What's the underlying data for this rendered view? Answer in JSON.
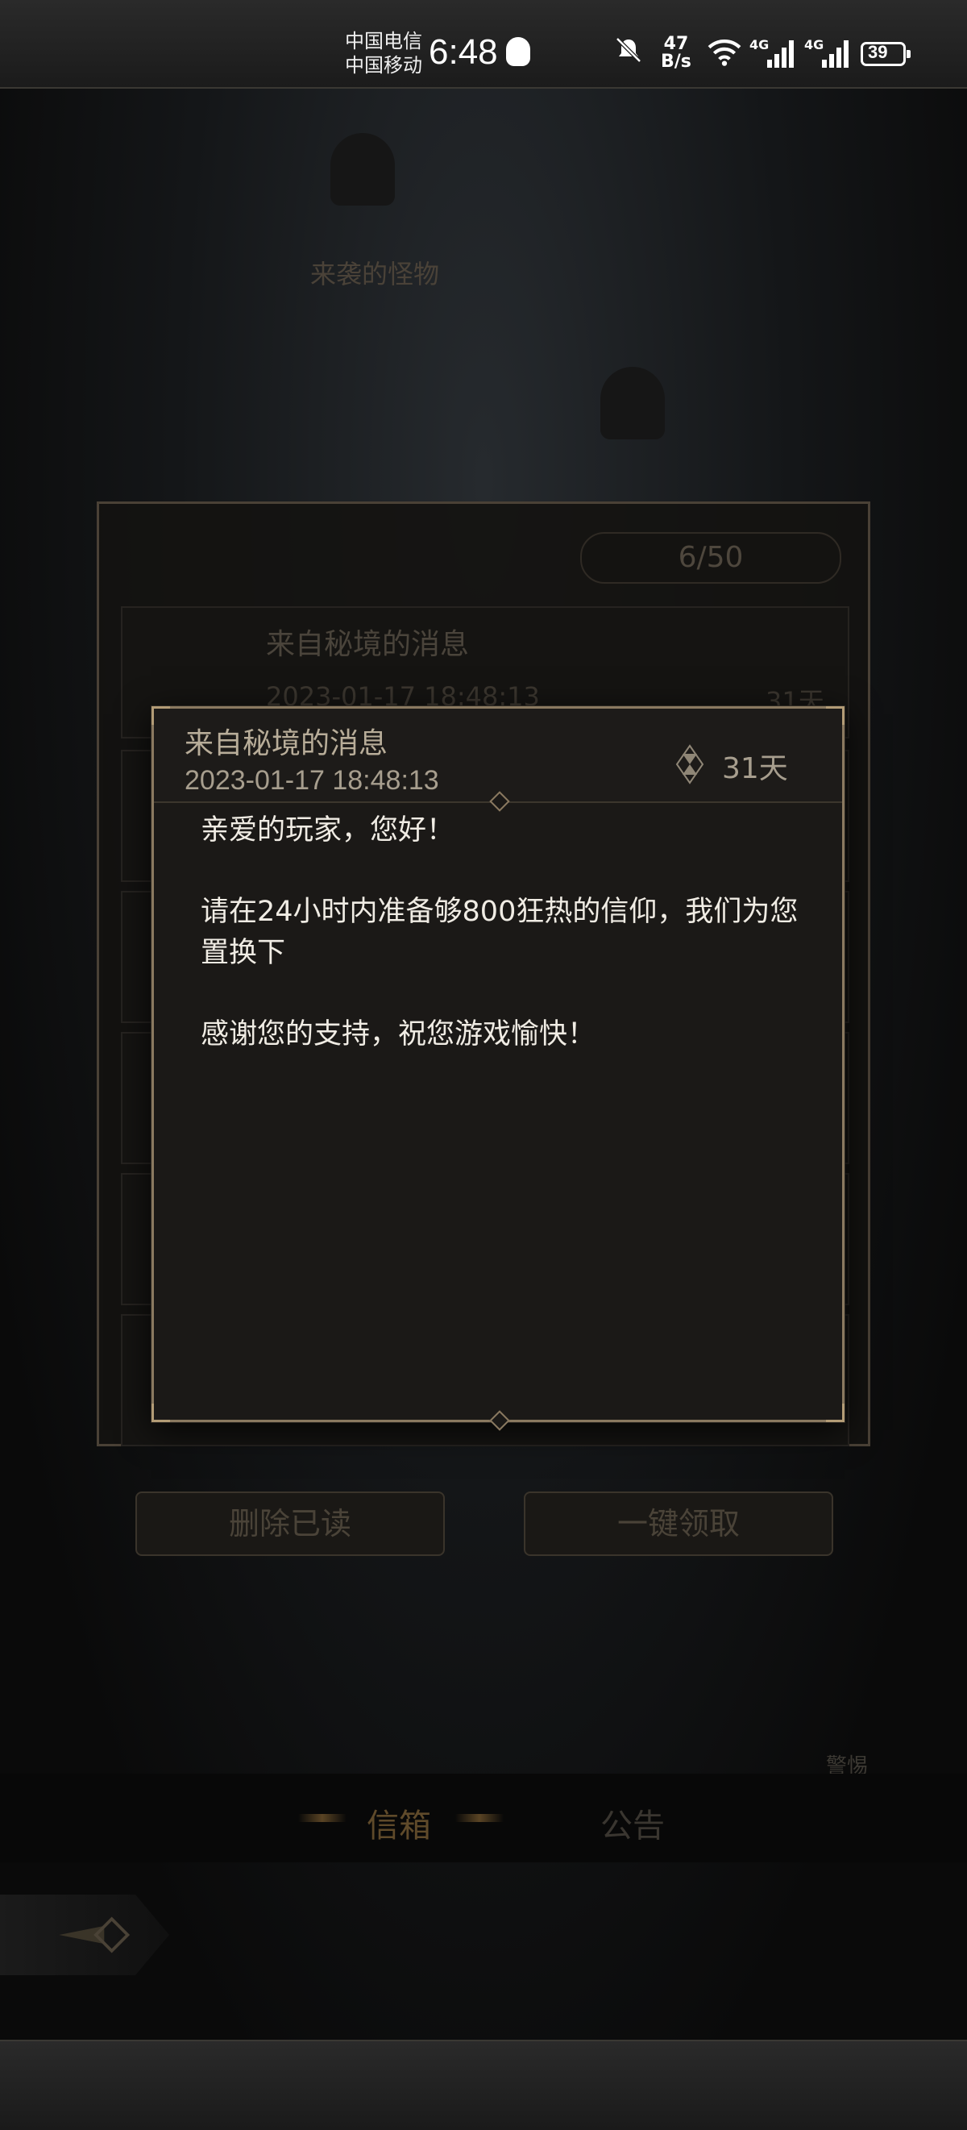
{
  "status_bar": {
    "carrier_1": "中国电信",
    "carrier_2": "中国移动",
    "time": "6:48",
    "net_speed_value": "47",
    "net_speed_unit": "B/s",
    "signal_1_label": "4G",
    "signal_2_label": "4G",
    "battery": "39"
  },
  "background": {
    "label_1": "来袭的怪物",
    "mail_counter": "6/50",
    "mail_item_title": "来自秘境的消息",
    "mail_item_date": "2023-01-17 18:48:13",
    "mail_item_days": "31天",
    "delete_read_button": "删除已读",
    "claim_all_button": "一键领取",
    "warning_label": "警惕",
    "tab_mail": "信箱",
    "tab_notice": "公告"
  },
  "dialog": {
    "title": "来自秘境的消息",
    "date": "2023-01-17 18:48:13",
    "days_left": "31天",
    "greeting": "亲爱的玩家，您好！",
    "paragraph": "请在24小时内准备够800狂热的信仰，我们为您置换下",
    "closing": "感谢您的支持，祝您游戏愉快！"
  }
}
